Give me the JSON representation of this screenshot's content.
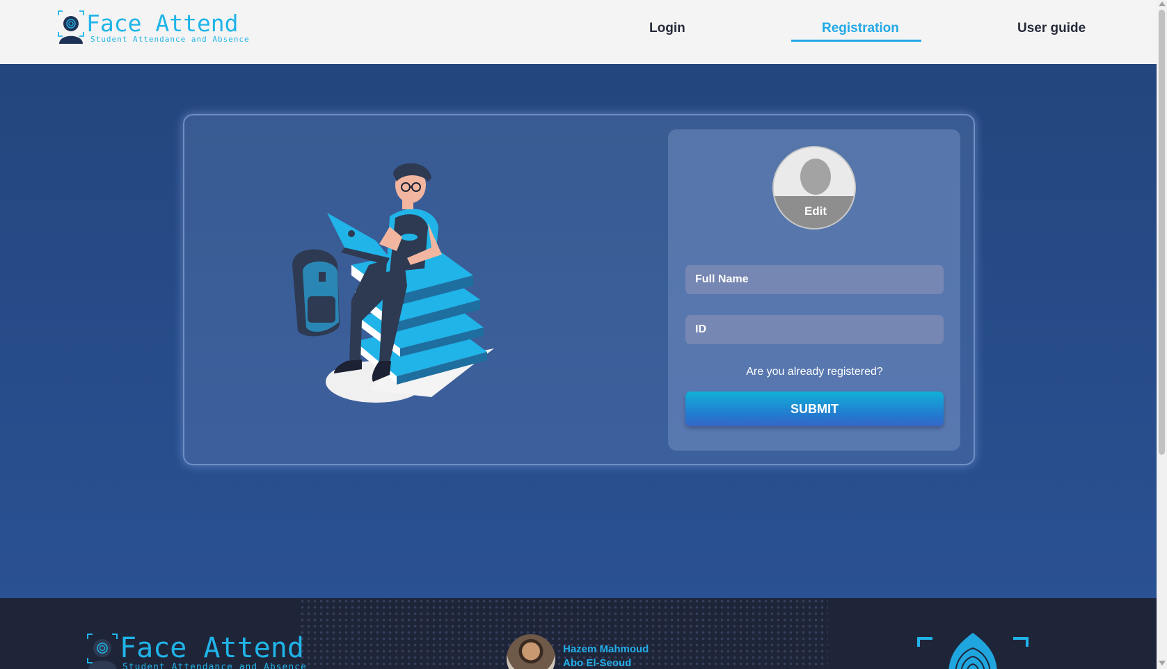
{
  "header": {
    "logo": {
      "brand": "Face Attend",
      "tagline": "Student Attendance and Absence"
    },
    "nav": [
      {
        "label": "Login",
        "active": false
      },
      {
        "label": "Registration",
        "active": true
      },
      {
        "label": "User guide",
        "active": false
      }
    ]
  },
  "form": {
    "avatar_edit_label": "Edit",
    "full_name_placeholder": "Full Name",
    "full_name_value": "",
    "id_placeholder": "ID",
    "id_value": "",
    "already_registered": "Are you already registered?",
    "submit_label": "SUBMIT"
  },
  "footer": {
    "logo": {
      "brand": "Face Attend",
      "tagline": "Student Attendance and Absence"
    },
    "developer": {
      "first_line": "Hazem Mahmoud",
      "second_line": "Abo El-Seoud"
    }
  },
  "colors": {
    "accent": "#22a8e6",
    "main_bg": "#24467e",
    "footer_bg": "#1f2539",
    "input_bg": "#7787b3"
  },
  "icons": [
    "face-logo-icon",
    "user-silhouette-icon",
    "fingerprint-icon",
    "scroll-up-icon",
    "scroll-down-icon"
  ]
}
